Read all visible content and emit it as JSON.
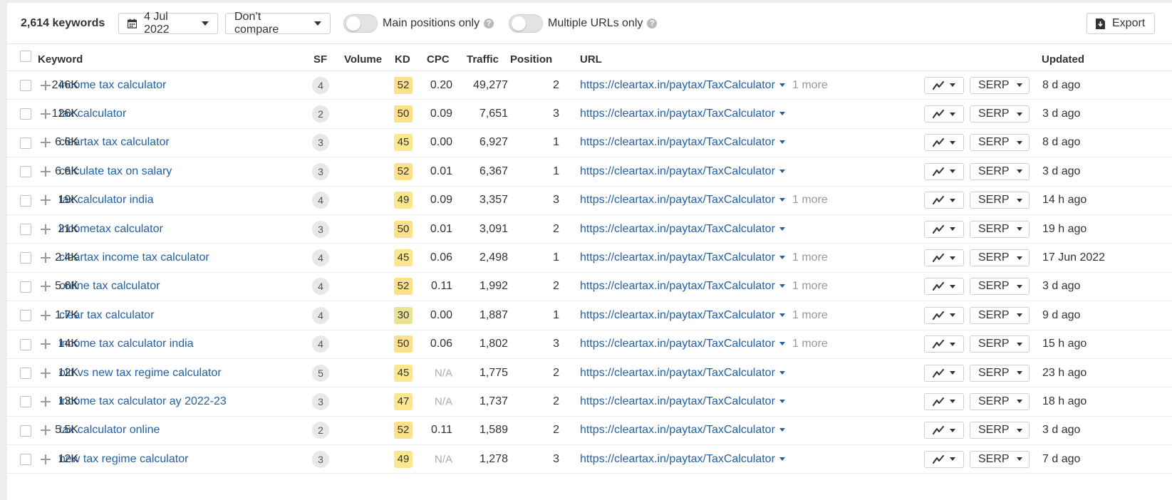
{
  "toolbar": {
    "keyword_count": "2,614 keywords",
    "date_label": "4 Jul 2022",
    "compare_label": "Don’t compare",
    "main_positions_label": "Main positions only",
    "multiple_urls_label": "Multiple URLs only",
    "help_glyph": "?",
    "export_label": "Export"
  },
  "table": {
    "headers": {
      "keyword": "Keyword",
      "sf": "SF",
      "volume": "Volume",
      "kd": "KD",
      "cpc": "CPC",
      "traffic": "Traffic",
      "position": "Position",
      "url": "URL",
      "updated": "Updated"
    },
    "serp_label": "SERP",
    "kd_colors": {
      "50s": "#fde08a",
      "40s": "#fbe88e",
      "30s": "#e9e493"
    },
    "rows": [
      {
        "keyword": "income tax calculator",
        "sf": "4",
        "volume": "246K",
        "kd": "52",
        "cpc": "0.20",
        "traffic": "49,277",
        "position": "2",
        "url": "https://cleartax.in/paytax/TaxCalculator",
        "more": "1 more",
        "updated": "8 d ago"
      },
      {
        "keyword": "tax calculator",
        "sf": "2",
        "volume": "126K",
        "kd": "50",
        "cpc": "0.09",
        "traffic": "7,651",
        "position": "3",
        "url": "https://cleartax.in/paytax/TaxCalculator",
        "more": "",
        "updated": "3 d ago"
      },
      {
        "keyword": "cleartax tax calculator",
        "sf": "3",
        "volume": "6.6K",
        "kd": "45",
        "cpc": "0.00",
        "traffic": "6,927",
        "position": "1",
        "url": "https://cleartax.in/paytax/TaxCalculator",
        "more": "",
        "updated": "8 d ago"
      },
      {
        "keyword": "calculate tax on salary",
        "sf": "3",
        "volume": "6.6K",
        "kd": "52",
        "cpc": "0.01",
        "traffic": "6,367",
        "position": "1",
        "url": "https://cleartax.in/paytax/TaxCalculator",
        "more": "",
        "updated": "3 d ago"
      },
      {
        "keyword": "tax calculator india",
        "sf": "4",
        "volume": "19K",
        "kd": "49",
        "cpc": "0.09",
        "traffic": "3,357",
        "position": "3",
        "url": "https://cleartax.in/paytax/TaxCalculator",
        "more": "1 more",
        "updated": "14 h ago"
      },
      {
        "keyword": "incometax calculator",
        "sf": "3",
        "volume": "21K",
        "kd": "50",
        "cpc": "0.01",
        "traffic": "3,091",
        "position": "2",
        "url": "https://cleartax.in/paytax/TaxCalculator",
        "more": "",
        "updated": "19 h ago"
      },
      {
        "keyword": "cleartax income tax calculator",
        "sf": "4",
        "volume": "2.4K",
        "kd": "45",
        "cpc": "0.06",
        "traffic": "2,498",
        "position": "1",
        "url": "https://cleartax.in/paytax/TaxCalculator",
        "more": "1 more",
        "updated": "17 Jun 2022"
      },
      {
        "keyword": "online tax calculator",
        "sf": "4",
        "volume": "5.6K",
        "kd": "52",
        "cpc": "0.11",
        "traffic": "1,992",
        "position": "2",
        "url": "https://cleartax.in/paytax/TaxCalculator",
        "more": "1 more",
        "updated": "3 d ago"
      },
      {
        "keyword": "clear tax calculator",
        "sf": "4",
        "volume": "1.7K",
        "kd": "30",
        "cpc": "0.00",
        "traffic": "1,887",
        "position": "1",
        "url": "https://cleartax.in/paytax/TaxCalculator",
        "more": "1 more",
        "updated": "9 d ago"
      },
      {
        "keyword": "income tax calculator india",
        "sf": "4",
        "volume": "14K",
        "kd": "50",
        "cpc": "0.06",
        "traffic": "1,802",
        "position": "3",
        "url": "https://cleartax.in/paytax/TaxCalculator",
        "more": "1 more",
        "updated": "15 h ago"
      },
      {
        "keyword": "old vs new tax regime calculator",
        "sf": "5",
        "volume": "12K",
        "kd": "45",
        "cpc": "N/A",
        "traffic": "1,775",
        "position": "2",
        "url": "https://cleartax.in/paytax/TaxCalculator",
        "more": "",
        "updated": "23 h ago"
      },
      {
        "keyword": "income tax calculator ay 2022-23",
        "sf": "3",
        "volume": "13K",
        "kd": "47",
        "cpc": "N/A",
        "traffic": "1,737",
        "position": "2",
        "url": "https://cleartax.in/paytax/TaxCalculator",
        "more": "",
        "updated": "18 h ago"
      },
      {
        "keyword": "tax calculator online",
        "sf": "2",
        "volume": "5.5K",
        "kd": "52",
        "cpc": "0.11",
        "traffic": "1,589",
        "position": "2",
        "url": "https://cleartax.in/paytax/TaxCalculator",
        "more": "",
        "updated": "3 d ago"
      },
      {
        "keyword": "new tax regime calculator",
        "sf": "3",
        "volume": "12K",
        "kd": "49",
        "cpc": "N/A",
        "traffic": "1,278",
        "position": "3",
        "url": "https://cleartax.in/paytax/TaxCalculator",
        "more": "",
        "updated": "7 d ago"
      }
    ]
  }
}
